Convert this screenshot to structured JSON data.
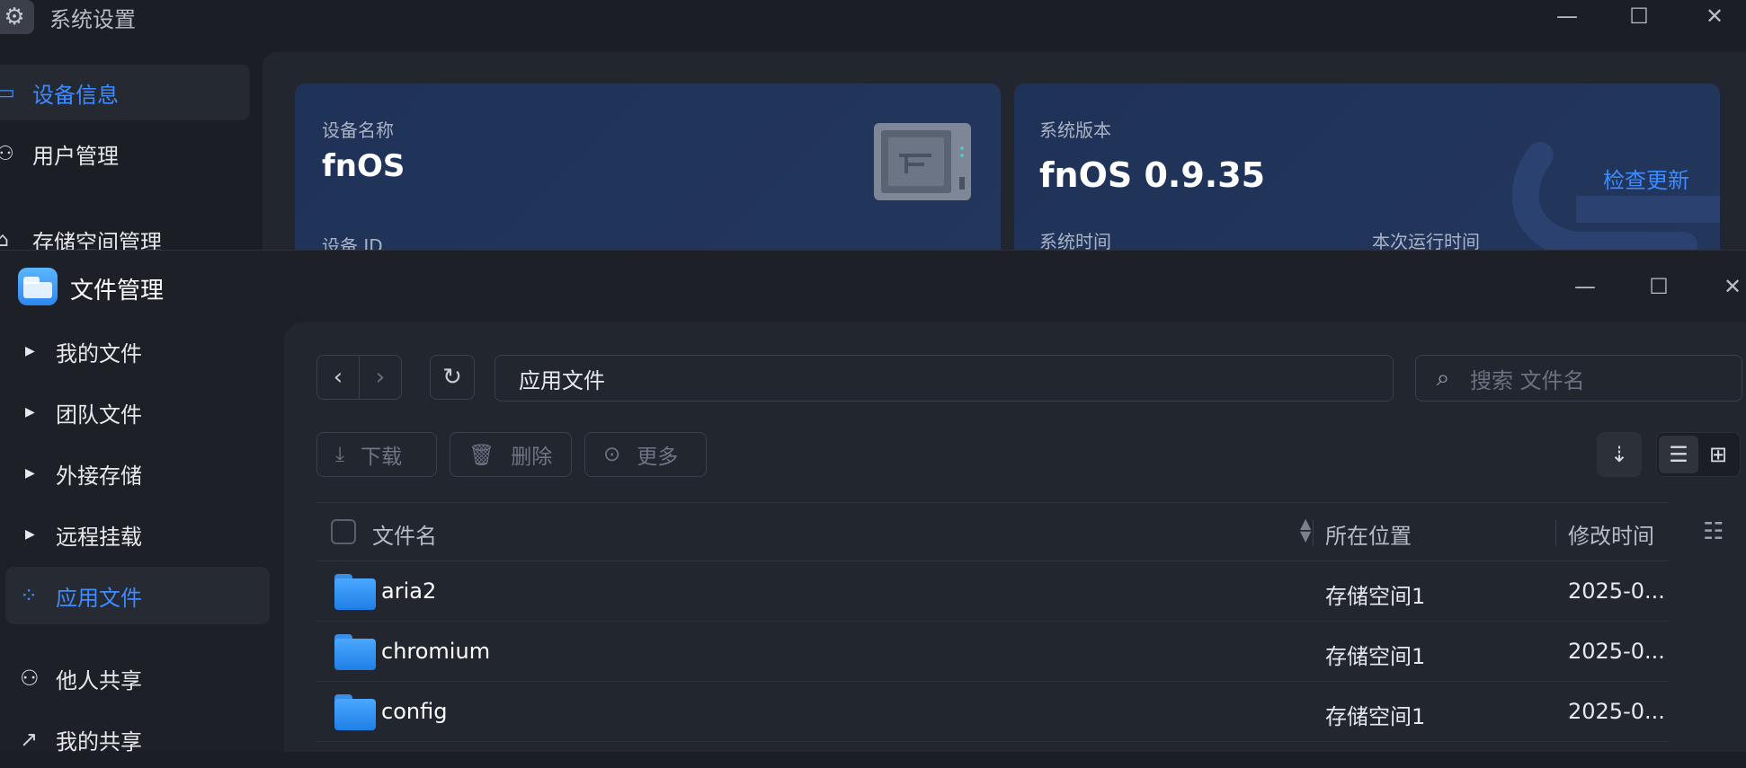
{
  "system_settings": {
    "title": "系统设置",
    "window_controls": {
      "minimize": "—",
      "maximize": "☐",
      "close": "✕"
    },
    "sidebar": [
      {
        "label": "设备信息",
        "icon": "drive-icon",
        "active": true
      },
      {
        "label": "用户管理",
        "icon": "user-gear-icon",
        "active": false
      },
      {
        "label": "存储空间管理",
        "icon": "storage-icon",
        "active": false
      }
    ],
    "device_card": {
      "name_label": "设备名称",
      "name_value": "fnOS",
      "id_label": "设备 ID"
    },
    "version_card": {
      "version_label": "系统版本",
      "version_value": "fnOS  0.9.35",
      "check_update": "检查更新",
      "time_label": "系统时间",
      "uptime_label": "本次运行时间"
    }
  },
  "file_manager": {
    "title": "文件管理",
    "window_controls": {
      "minimize": "—",
      "maximize": "☐",
      "close": "✕"
    },
    "sidebar": [
      {
        "label": "我的文件",
        "type": "expandable"
      },
      {
        "label": "团队文件",
        "type": "expandable"
      },
      {
        "label": "外接存储",
        "type": "expandable"
      },
      {
        "label": "远程挂载",
        "type": "expandable"
      },
      {
        "label": "应用文件",
        "type": "icon",
        "icon": "apps-icon",
        "active": true
      },
      {
        "label": "他人共享",
        "type": "icon",
        "icon": "people-icon"
      },
      {
        "label": "我的共享",
        "type": "icon",
        "icon": "share-icon"
      }
    ],
    "toolbar": {
      "back": "‹",
      "forward": "›",
      "refresh": "↻",
      "path": "应用文件",
      "search_placeholder": "搜索 文件名"
    },
    "actions": {
      "download": "下载",
      "delete": "删除",
      "more": "更多"
    },
    "table": {
      "columns": {
        "name": "文件名",
        "location": "所在位置",
        "modified": "修改时间"
      },
      "rows": [
        {
          "name": "aria2",
          "location": "存储空间1",
          "modified": "2025-0..."
        },
        {
          "name": "chromium",
          "location": "存储空间1",
          "modified": "2025-0..."
        },
        {
          "name": "config",
          "location": "存储空间1",
          "modified": "2025-0..."
        }
      ]
    }
  },
  "colors": {
    "accent": "#3d8bff",
    "background": "#1b1e25",
    "card": "#1f3257"
  }
}
